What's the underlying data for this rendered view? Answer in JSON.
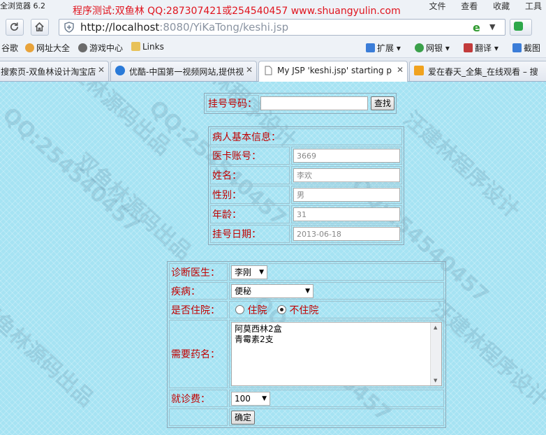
{
  "browser": {
    "app_name": "全浏览器 6.2",
    "title_banner": "程序测试:双鱼林 QQ:287307421或254540457 www.shuangyulin.com",
    "menu": [
      "文件",
      "查看",
      "收藏",
      "工具"
    ],
    "url_host": "http://localhost",
    "url_rest": ":8080/YiKaTong/keshi.jsp"
  },
  "bookmarks": [
    {
      "label": "谷歌",
      "color": "#dd4b39"
    },
    {
      "label": "网址大全",
      "color": "#e8a33a"
    },
    {
      "label": "游戏中心",
      "color": "#6b6b6b"
    },
    {
      "label": "Links",
      "color": "#e8c25a"
    },
    {
      "label": "扩展",
      "color": "#3b7dd8"
    },
    {
      "label": "网银",
      "color": "#3aa04a"
    },
    {
      "label": "翻译",
      "color": "#c23b3b"
    },
    {
      "label": "截图",
      "color": "#3b7dd8"
    }
  ],
  "tabs": [
    {
      "title": "搜索页-双鱼林设计淘宝店",
      "icon": "page-icon",
      "color": "#9aa8bb"
    },
    {
      "title": "优酷-中国第一视频网站,提供视",
      "icon": "youku-icon",
      "color": "#2a7ad8"
    },
    {
      "title": "My JSP 'keshi.jsp' starting p",
      "icon": "document-icon",
      "color": "#ffffff"
    },
    {
      "title": "爱在春天_全集_在线观看 – 搜",
      "icon": "soku-icon",
      "color": "#f0a21e"
    }
  ],
  "search_form": {
    "label": "挂号号码：",
    "value": "",
    "button": "查找"
  },
  "patient": {
    "header": "病人基本信息：",
    "fields": [
      {
        "label": "医卡账号：",
        "value": "3669"
      },
      {
        "label": "姓名：",
        "value": "李欢"
      },
      {
        "label": "性别：",
        "value": "男"
      },
      {
        "label": "年龄：",
        "value": "31"
      },
      {
        "label": "挂号日期：",
        "value": "2013-06-18"
      }
    ]
  },
  "diagnosis": {
    "doctor_label": "诊断医生：",
    "doctor_value": "李刚",
    "disease_label": "疾病：",
    "disease_value": "便秘",
    "hospital_label": "是否住院：",
    "hospital_options": [
      "住院",
      "不住院"
    ],
    "hospital_selected": "不住院",
    "medicine_label": "需要药名：",
    "medicine_value": "阿莫西林2盒\n青霉素2支",
    "fee_label": "就诊费：",
    "fee_value": "100",
    "submit": "确定"
  },
  "watermark": [
    "双鱼林源码出品",
    "QQ:254540457",
    "汪建林程序设计",
    "QQ:254540457",
    "双鱼林源码出品",
    "汪建林程序设计",
    "QQ:254540457",
    "双鱼林源码出品",
    "QQ:254540457",
    "汪建林程序设计"
  ]
}
